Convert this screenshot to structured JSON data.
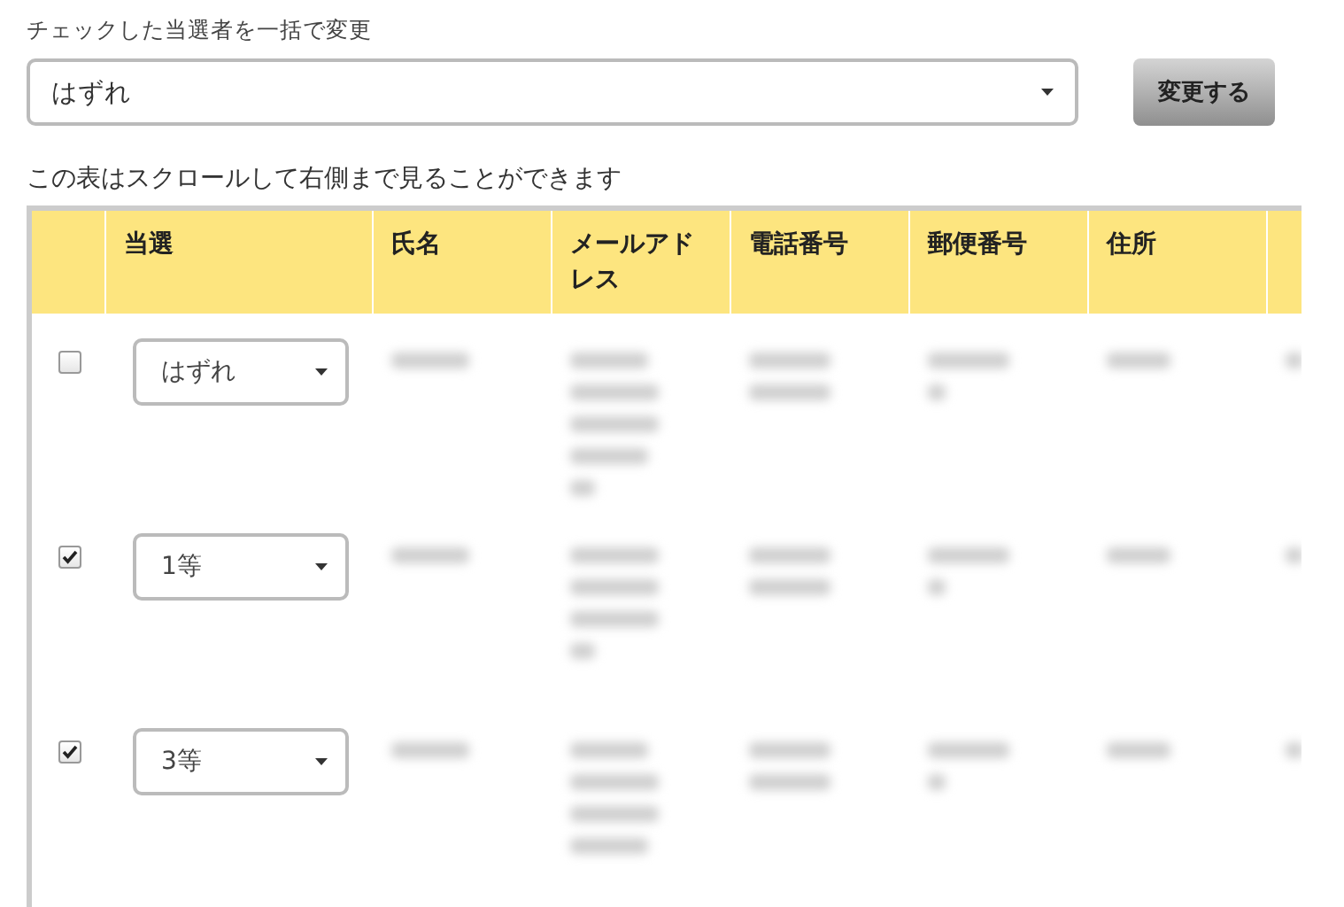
{
  "bulk_change": {
    "label": "チェックした当選者を一括で変更",
    "select_value": "はずれ",
    "button": "変更する"
  },
  "table_note": "この表はスクロールして右側まで見ることができます",
  "table": {
    "columns": [
      "当選",
      "氏名",
      "メールアドレス",
      "電話番号",
      "郵便番号",
      "住所"
    ],
    "rows": [
      {
        "checked": false,
        "prize": "はずれ"
      },
      {
        "checked": true,
        "prize": "1等"
      },
      {
        "checked": true,
        "prize": "3等"
      }
    ]
  }
}
